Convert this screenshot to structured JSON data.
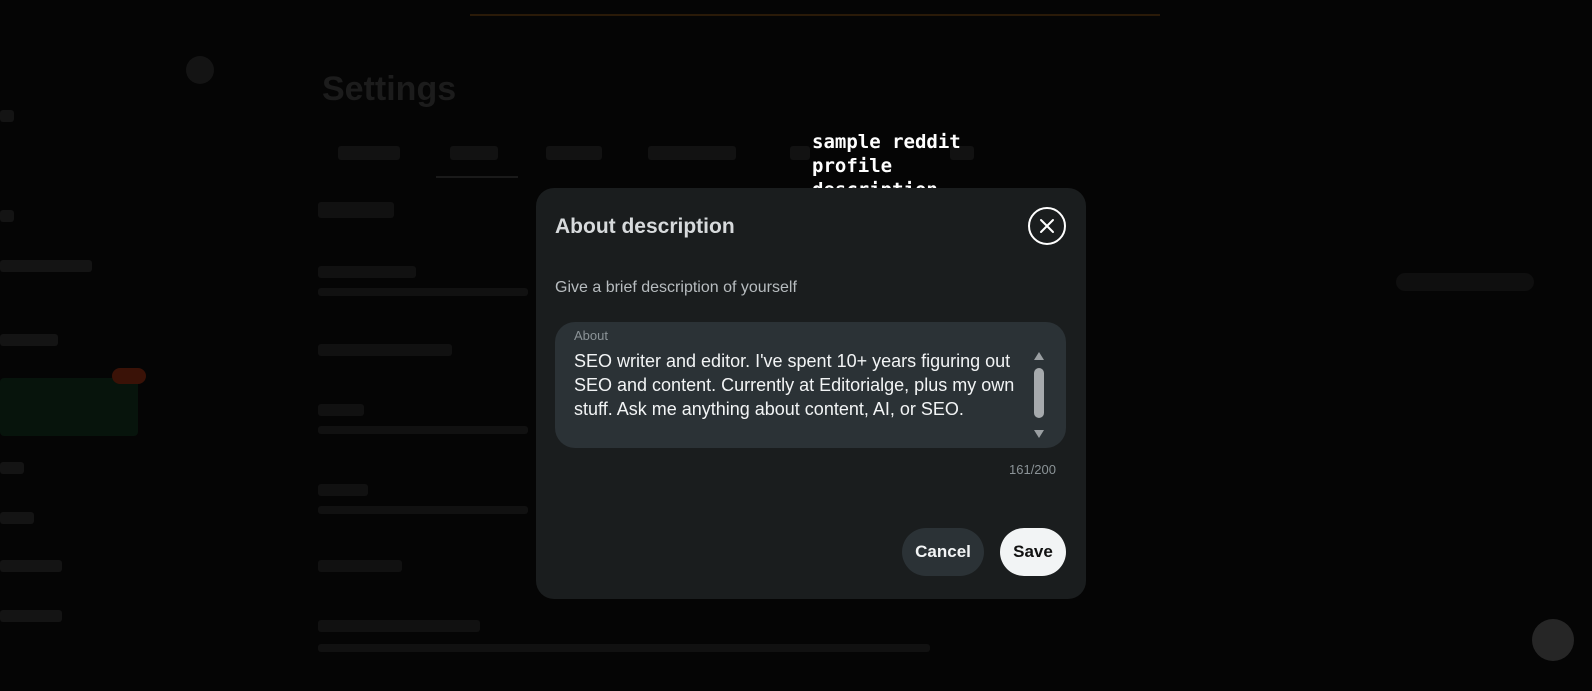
{
  "background": {
    "page_title": "Settings"
  },
  "annotation": {
    "text": "sample reddit\nprofile\ndescription",
    "arrow_color": "#e0242b"
  },
  "modal": {
    "title": "About description",
    "close_icon": "close-icon",
    "subtitle": "Give a brief description of yourself",
    "field_label": "About",
    "about_value": "SEO writer and editor. I've spent 10+ years figuring out SEO and content. Currently at Editorialge, plus my own stuff. Ask me anything about content, AI, or SEO.",
    "char_count": "161/200",
    "cancel_label": "Cancel",
    "save_label": "Save"
  },
  "colors": {
    "modal_bg": "#1a1d1e",
    "field_bg": "#2b3236",
    "save_bg": "#f2f4f5"
  }
}
